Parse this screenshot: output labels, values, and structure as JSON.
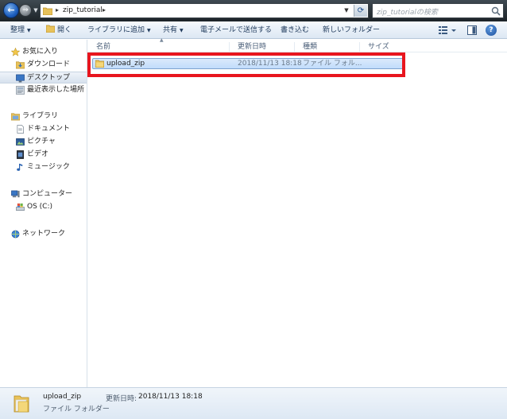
{
  "address": {
    "crumb": "zip_tutorial",
    "separator": "▸",
    "search_placeholder": "zip_tutorialの検索"
  },
  "toolbar": {
    "organize": "整理",
    "open": "開く",
    "add_to_library": "ライブラリに追加",
    "share": "共有",
    "email": "電子メールで送信する",
    "burn": "書き込む",
    "new_folder": "新しいフォルダー",
    "help": "?"
  },
  "navigation": {
    "favorites": "お気に入り",
    "downloads": "ダウンロード",
    "desktop": "デスクトップ",
    "recent": "最近表示した場所",
    "libraries": "ライブラリ",
    "documents": "ドキュメント",
    "pictures": "ピクチャ",
    "videos": "ビデオ",
    "music": "ミュージック",
    "computer": "コンピューター",
    "os_drive": "OS (C:)",
    "network": "ネットワーク"
  },
  "columns": {
    "name": "名前",
    "modified": "更新日時",
    "type": "種類",
    "size": "サイズ"
  },
  "files": [
    {
      "name": "upload_zip",
      "modified": "2018/11/13 18:18",
      "type": "ファイル フォル..."
    }
  ],
  "details": {
    "name": "upload_zip",
    "type": "ファイル フォルダー",
    "modified_label": "更新日時:",
    "modified_value": "2018/11/13 18:18"
  },
  "colors": {
    "highlight": "#e8151e",
    "selection": "#c1dcfb",
    "toolbar_text": "#1e395b"
  }
}
